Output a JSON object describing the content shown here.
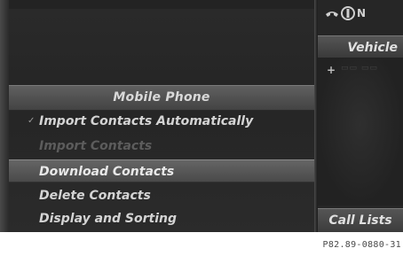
{
  "menu": {
    "title": "Mobile Phone",
    "items": [
      {
        "label": "Import Contacts Automatically",
        "checked": true,
        "state": "normal"
      },
      {
        "label": "Import Contacts",
        "state": "disabled"
      },
      {
        "label": "Download Contacts",
        "state": "selected"
      },
      {
        "label": "Delete Contacts",
        "state": "normal"
      },
      {
        "label": "Display and Sorting",
        "state": "normal"
      }
    ]
  },
  "status_bar": {
    "phone_icon": "phone-handset-icon",
    "signal_icon": "signal-icon",
    "label": "N"
  },
  "right_panel": {
    "vehicle_label": "Vehicle",
    "call_lists_label": "Call Lists"
  },
  "footer": {
    "code": "P82.89-0880-31"
  }
}
